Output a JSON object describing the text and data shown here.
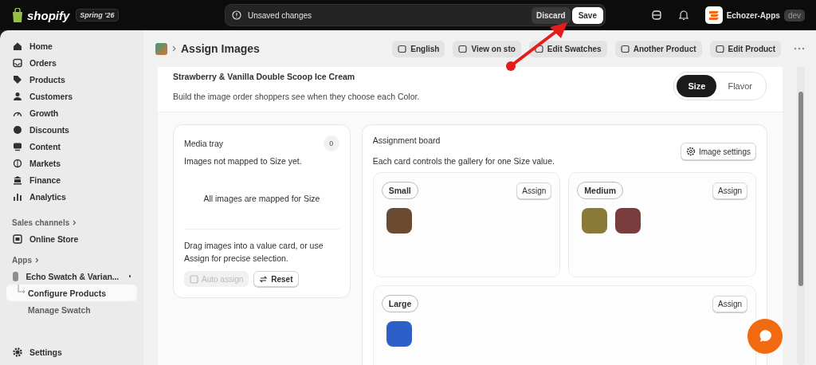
{
  "topbar": {
    "brand": "shopify",
    "edition": "Spring '26",
    "alert": "Unsaved changes",
    "discard": "Discard",
    "save": "Save",
    "store": "Echozer-Apps",
    "store_badge": "dev"
  },
  "sidebar": {
    "items": [
      {
        "kind": "nav",
        "label": "Home",
        "selected": false
      },
      {
        "kind": "nav",
        "label": "Orders",
        "selected": false
      },
      {
        "kind": "nav",
        "label": "Products",
        "selected": false
      },
      {
        "kind": "nav",
        "label": "Customers",
        "selected": false
      },
      {
        "kind": "nav",
        "label": "Growth",
        "selected": false
      },
      {
        "kind": "nav",
        "label": "Discounts",
        "selected": false
      },
      {
        "kind": "nav",
        "label": "Content",
        "selected": false
      },
      {
        "kind": "nav",
        "label": "Markets",
        "selected": false
      },
      {
        "kind": "nav",
        "label": "Finance",
        "selected": false
      },
      {
        "kind": "nav",
        "label": "Analytics",
        "selected": false
      },
      {
        "kind": "section",
        "label": "Sales channels"
      },
      {
        "kind": "nav",
        "label": "Online Store",
        "selected": false
      },
      {
        "kind": "section",
        "label": "Apps"
      },
      {
        "kind": "app",
        "label": "Echo Swatch & Varian...",
        "selected": false
      },
      {
        "kind": "sub",
        "label": "Configure Products",
        "selected": true
      },
      {
        "kind": "sub",
        "label": "Manage Swatch",
        "selected": false
      }
    ],
    "settings": "Settings"
  },
  "header": {
    "title": "Assign Images",
    "actions": [
      "English",
      "View on sto",
      "Edit Swatches",
      "Another Product",
      "Edit Product"
    ]
  },
  "product": {
    "title": "Strawberry & Vanilla Double Scoop Ice Cream",
    "description": "Build the image order shoppers see when they choose each Color.",
    "options": [
      {
        "label": "Size",
        "selected": true
      },
      {
        "label": "Flavor",
        "selected": false
      }
    ]
  },
  "media_tray": {
    "title": "Media tray",
    "count": "0",
    "subtitle": "Images not mapped to Size yet.",
    "empty": "All images are mapped for Size",
    "hint": "Drag images into a value card, or use Assign for precise selection.",
    "auto_assign": {
      "label": "Auto assign",
      "disabled": true
    },
    "reset": "Reset"
  },
  "board": {
    "title": "Assignment board",
    "subtitle": "Each card controls the gallery for one Size value.",
    "settings": "Image settings",
    "cards": [
      {
        "value": "Small",
        "assign": "Assign",
        "images": [
          {
            "color": "#6b4a32"
          }
        ]
      },
      {
        "value": "Medium",
        "assign": "Assign",
        "images": [
          {
            "color": "#8a7a3a"
          },
          {
            "color": "#7a3d3d"
          }
        ]
      },
      {
        "value": "Large",
        "assign": "Assign",
        "images": [
          {
            "color": "#2c5fc8"
          }
        ]
      }
    ]
  },
  "annotation": {
    "kind": "arrow"
  }
}
